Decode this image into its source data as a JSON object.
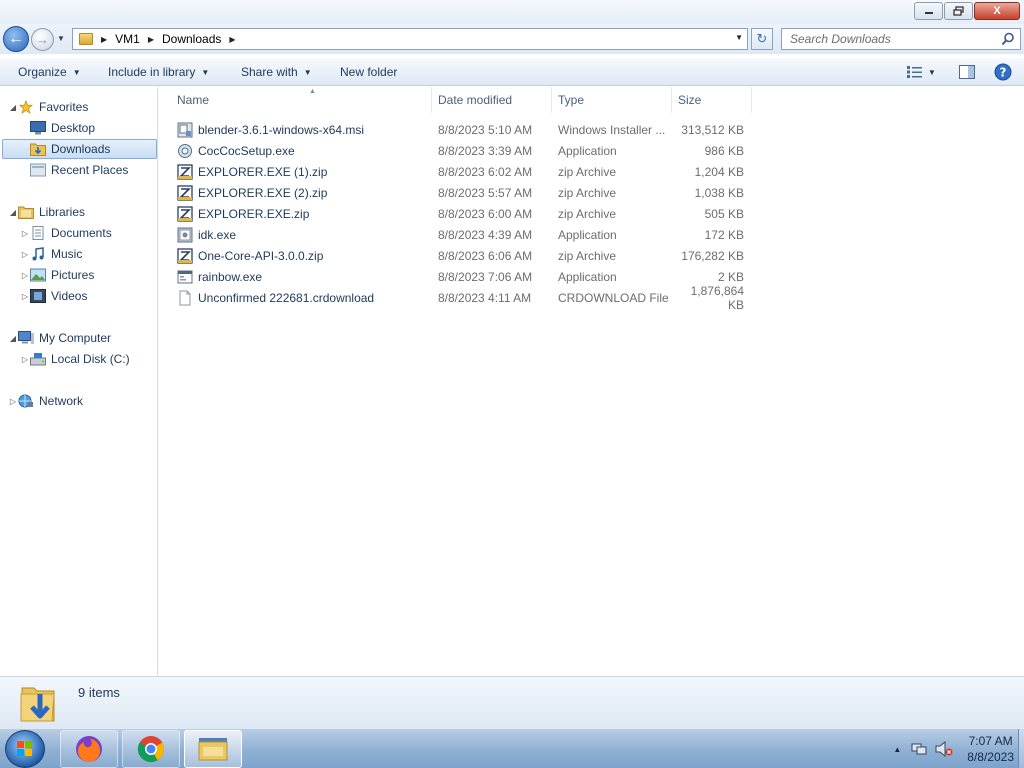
{
  "window": {
    "minimize_icon": "minimize-icon",
    "maximize_icon": "maximize-icon",
    "close_label": "X"
  },
  "address": {
    "segments": [
      "VM1",
      "Downloads"
    ],
    "search_placeholder": "Search Downloads"
  },
  "commands": {
    "organize": "Organize",
    "include_in_library": "Include in library",
    "share_with": "Share with",
    "new_folder": "New folder"
  },
  "nav": {
    "favorites": "Favorites",
    "desktop": "Desktop",
    "downloads": "Downloads",
    "recent_places": "Recent Places",
    "libraries": "Libraries",
    "documents": "Documents",
    "music": "Music",
    "pictures": "Pictures",
    "videos": "Videos",
    "my_computer": "My Computer",
    "local_disk": "Local Disk (C:)",
    "network": "Network"
  },
  "columns": {
    "name": "Name",
    "date_modified": "Date modified",
    "type": "Type",
    "size": "Size"
  },
  "files": [
    {
      "name": "blender-3.6.1-windows-x64.msi",
      "date": "8/8/2023 5:10 AM",
      "type": "Windows Installer ...",
      "size": "313,512 KB",
      "icon": "msi-icon"
    },
    {
      "name": "CocCocSetup.exe",
      "date": "8/8/2023 3:39 AM",
      "type": "Application",
      "size": "986 KB",
      "icon": "setup-exe-icon"
    },
    {
      "name": "EXPLORER.EXE (1).zip",
      "date": "8/8/2023 6:02 AM",
      "type": "zip Archive",
      "size": "1,204 KB",
      "icon": "zip-icon"
    },
    {
      "name": "EXPLORER.EXE (2).zip",
      "date": "8/8/2023 5:57 AM",
      "type": "zip Archive",
      "size": "1,038 KB",
      "icon": "zip-icon"
    },
    {
      "name": "EXPLORER.EXE.zip",
      "date": "8/8/2023 6:00 AM",
      "type": "zip Archive",
      "size": "505 KB",
      "icon": "zip-icon"
    },
    {
      "name": "idk.exe",
      "date": "8/8/2023 4:39 AM",
      "type": "Application",
      "size": "172 KB",
      "icon": "exe-icon"
    },
    {
      "name": "One-Core-API-3.0.0.zip",
      "date": "8/8/2023 6:06 AM",
      "type": "zip Archive",
      "size": "176,282 KB",
      "icon": "zip-icon"
    },
    {
      "name": "rainbow.exe",
      "date": "8/8/2023 7:06 AM",
      "type": "Application",
      "size": "2 KB",
      "icon": "app-window-icon"
    },
    {
      "name": "Unconfirmed 222681.crdownload",
      "date": "8/8/2023 4:11 AM",
      "type": "CRDOWNLOAD File",
      "size": "1,876,864 KB",
      "icon": "blank-file-icon"
    }
  ],
  "details": {
    "count": "9 items"
  },
  "taskbar": {
    "time": "7:07 AM",
    "date": "8/8/2023"
  },
  "colors": {
    "accent": "#1e395b",
    "selection": "#c8ddf4",
    "folder": "#e8c25a"
  }
}
